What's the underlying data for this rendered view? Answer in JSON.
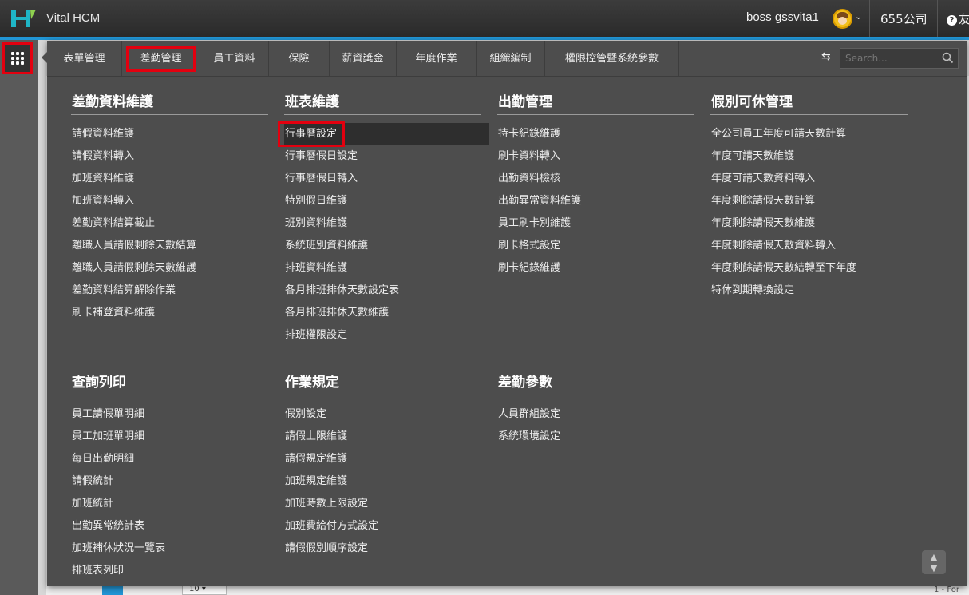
{
  "header": {
    "app_name": "Vital HCM",
    "user": "boss gssvita1",
    "company": "655公司",
    "help": "友"
  },
  "tabs": [
    "表單管理",
    "差勤管理",
    "員工資料",
    "保險",
    "薪資獎金",
    "年度作業",
    "組織編制",
    "權限控管暨系統參數"
  ],
  "search": {
    "placeholder": "Search..."
  },
  "sections": {
    "s1": {
      "title": "差勤資料維護",
      "items": [
        "請假資料維護",
        "請假資料轉入",
        "加班資料維護",
        "加班資料轉入",
        "差勤資料結算截止",
        "離職人員請假剩餘天數結算",
        "離職人員請假剩餘天數維護",
        "差勤資料結算解除作業",
        "刷卡補登資料維護"
      ]
    },
    "s2": {
      "title": "班表維護",
      "items": [
        "行事曆設定",
        "行事曆假日設定",
        "行事曆假日轉入",
        "特別假日維護",
        "班別資料維護",
        "系統班別資料維護",
        "排班資料維護",
        "各月排班排休天數設定表",
        "各月排班排休天數維護",
        "排班權限設定"
      ]
    },
    "s3": {
      "title": "出勤管理",
      "items": [
        "持卡紀錄維護",
        "刷卡資料轉入",
        "出勤資料檢核",
        "出勤異常資料維護",
        "員工刷卡別維護",
        "刷卡格式設定",
        "刷卡紀錄維護"
      ]
    },
    "s4": {
      "title": "假別可休管理",
      "items": [
        "全公司員工年度可請天數計算",
        "年度可請天數維護",
        "年度可請天數資料轉入",
        "年度剩餘請假天數計算",
        "年度剩餘請假天數維護",
        "年度剩餘請假天數資料轉入",
        "年度剩餘請假天數結轉至下年度",
        "特休到期轉換設定"
      ]
    },
    "s5": {
      "title": "查詢列印",
      "items": [
        "員工請假單明細",
        "員工加班單明細",
        "每日出勤明細",
        "請假統計",
        "加班統計",
        "出勤異常統計表",
        "加班補休狀況一覽表",
        "排班表列印"
      ]
    },
    "s6": {
      "title": "作業規定",
      "items": [
        "假別設定",
        "請假上限維護",
        "請假規定維護",
        "加班規定維護",
        "加班時數上限設定",
        "加班費給付方式設定",
        "請假假別順序設定"
      ]
    },
    "s7": {
      "title": "差勤參數",
      "items": [
        "人員群組設定",
        "系統環境設定"
      ]
    }
  },
  "background": {
    "page_size": "10",
    "footer": "1 - For"
  },
  "colors": {
    "highlight": "#e3000f",
    "accent": "#2196d6",
    "menu_bg": "#4d4d4d"
  }
}
